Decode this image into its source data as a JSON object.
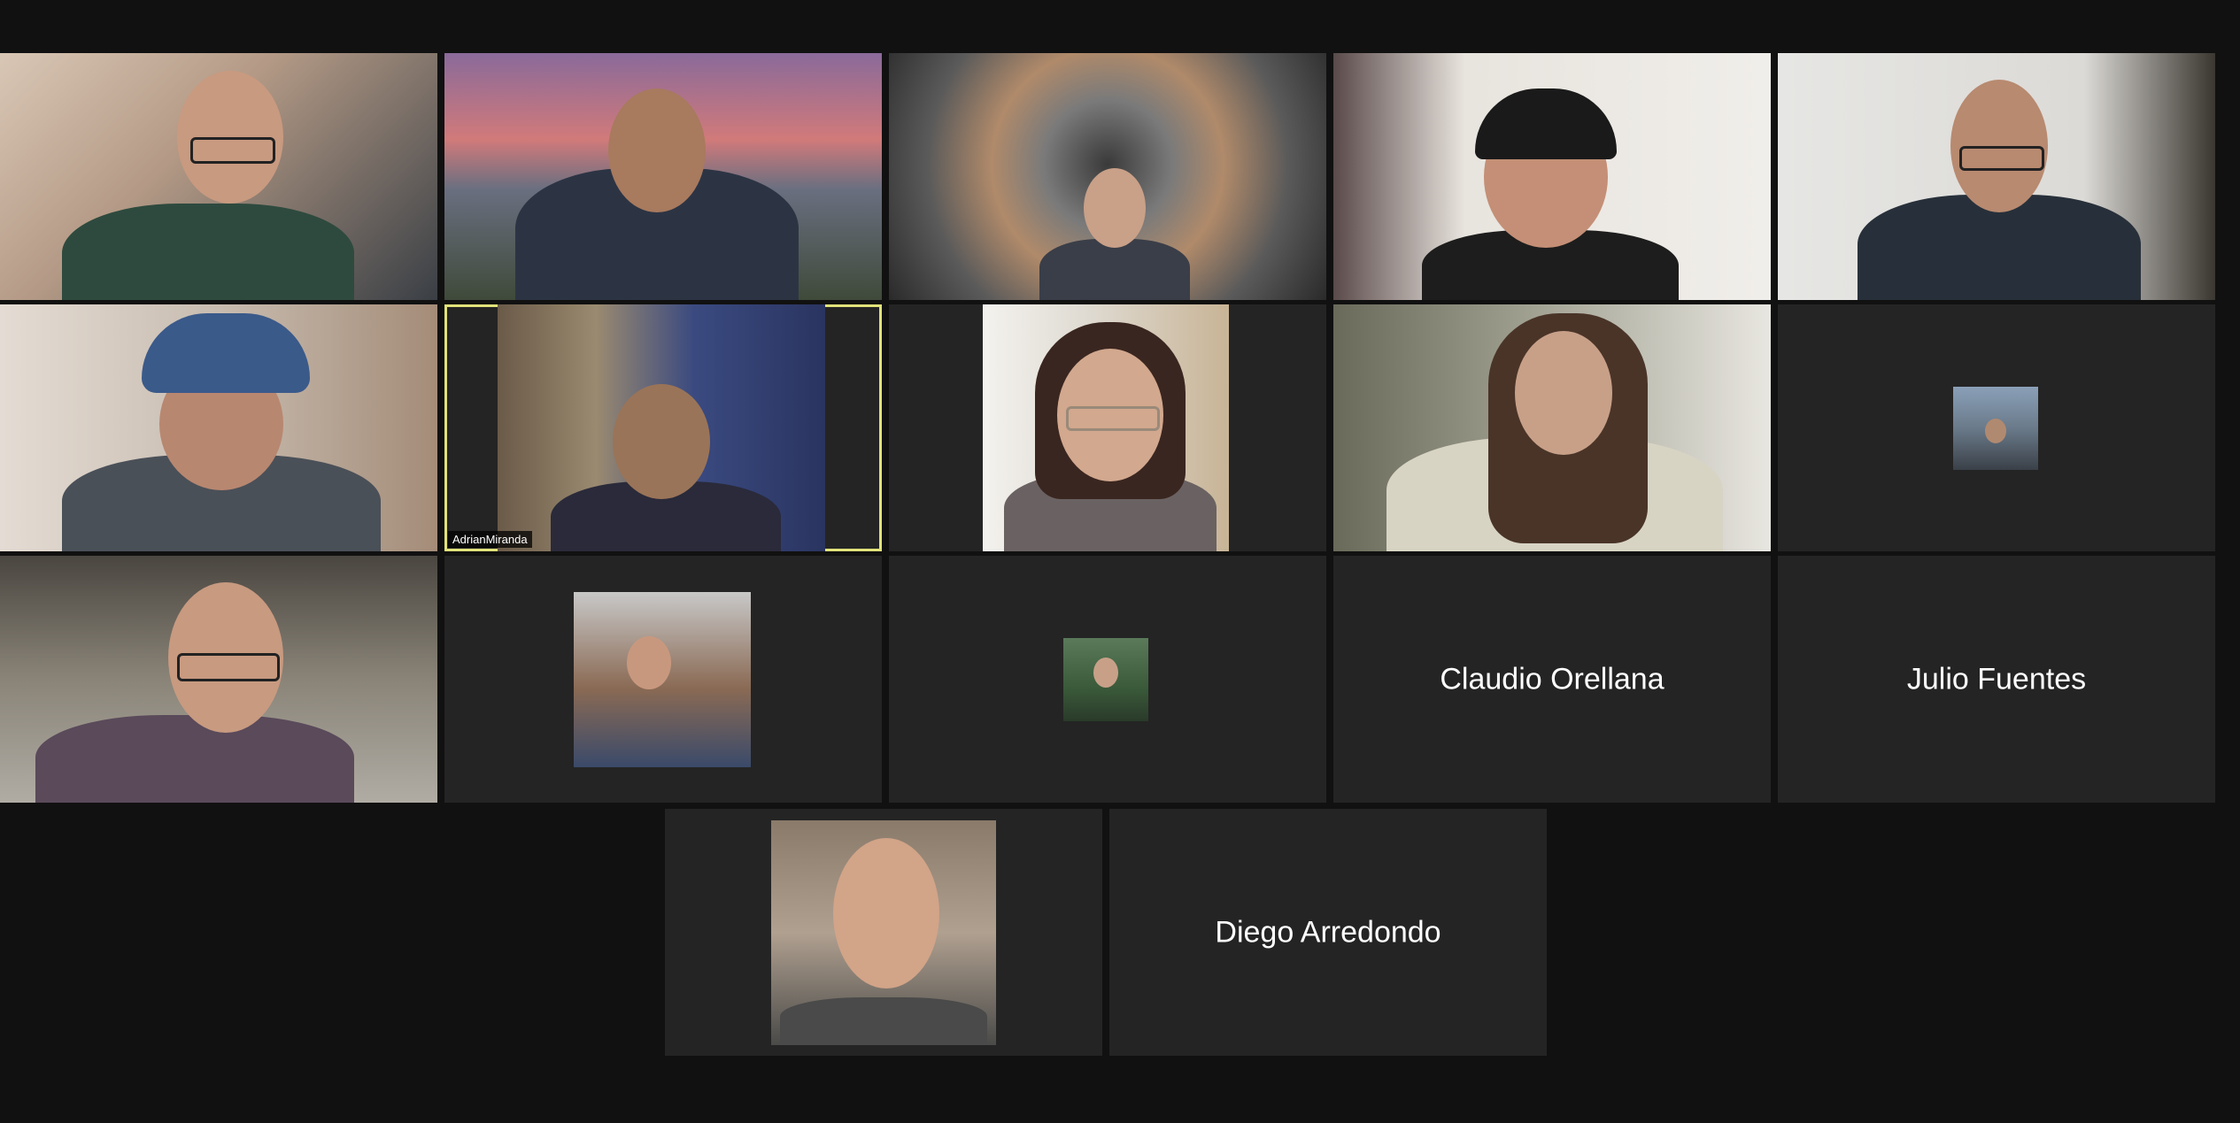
{
  "participants": [
    {
      "name": "",
      "type": "video"
    },
    {
      "name": "",
      "type": "video"
    },
    {
      "name": "",
      "type": "video"
    },
    {
      "name": "",
      "type": "video"
    },
    {
      "name": "",
      "type": "video"
    },
    {
      "name": "",
      "type": "video"
    },
    {
      "name": "AdrianMiranda",
      "type": "video",
      "active_speaker": true
    },
    {
      "name": "",
      "type": "video"
    },
    {
      "name": "",
      "type": "video"
    },
    {
      "name": "",
      "type": "profile-picture"
    },
    {
      "name": "",
      "type": "video"
    },
    {
      "name": "",
      "type": "profile-picture"
    },
    {
      "name": "",
      "type": "profile-picture"
    },
    {
      "name": "Claudio Orellana",
      "type": "name-only"
    },
    {
      "name": "Julio Fuentes",
      "type": "name-only"
    },
    {
      "name": "",
      "type": "profile-picture"
    },
    {
      "name": "Diego Arredondo",
      "type": "name-only"
    }
  ],
  "colors": {
    "background": "#111111",
    "tile": "#242424",
    "active_border": "#e1e37a"
  }
}
